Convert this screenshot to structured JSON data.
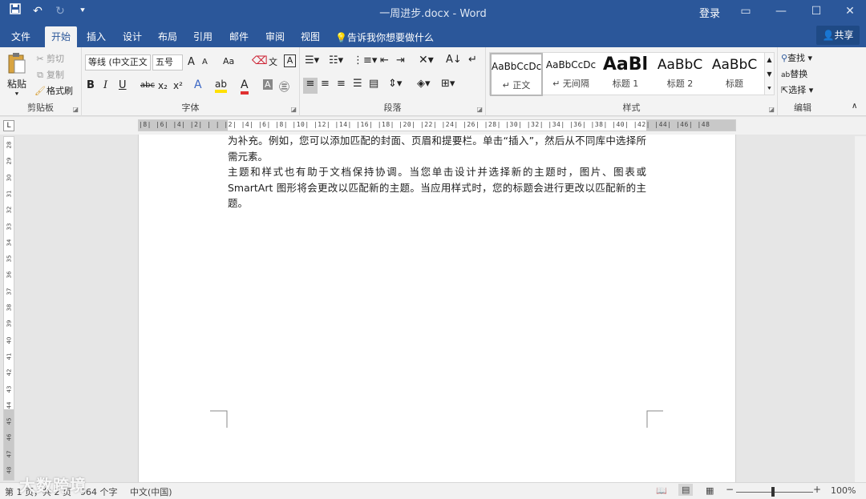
{
  "titlebar": {
    "title": "一周进步.docx - Word",
    "login": "登录",
    "qat": {
      "save_icon": "save-icon",
      "undo_icon": "undo-icon",
      "redo_icon": "redo-icon",
      "customize_icon": "customize-icon"
    },
    "window_buttons": {
      "ribbon_display": "▭",
      "minimize": "—",
      "maximize": "☐",
      "close": "✕"
    }
  },
  "tabs": [
    {
      "label": "文件"
    },
    {
      "label": "开始"
    },
    {
      "label": "插入"
    },
    {
      "label": "设计"
    },
    {
      "label": "布局"
    },
    {
      "label": "引用"
    },
    {
      "label": "邮件"
    },
    {
      "label": "审阅"
    },
    {
      "label": "视图"
    }
  ],
  "tellme": "告诉我你想要做什么",
  "share": "共享",
  "ribbon": {
    "clipboard": {
      "paste": "粘贴",
      "cut": "剪切",
      "copy": "复制",
      "format_painter": "格式刷",
      "label": "剪贴板"
    },
    "font": {
      "font_name": "等线 (中文正文",
      "font_size": "五号",
      "grow": "A",
      "shrink": "A",
      "case": "Aa",
      "bold": "B",
      "italic": "I",
      "underline": "U",
      "strike": "abc",
      "sub": "x₂",
      "sup": "x²",
      "label": "字体"
    },
    "paragraph": {
      "label": "段落"
    },
    "styles": {
      "label": "样式",
      "items": [
        {
          "preview": "AaBbCcDc",
          "name": "↵ 正文"
        },
        {
          "preview": "AaBbCcDc",
          "name": "↵ 无间隔"
        },
        {
          "preview": "AaBl",
          "name": "标题 1"
        },
        {
          "preview": "AaBbC",
          "name": "标题 2"
        },
        {
          "preview": "AaBbC",
          "name": "标题"
        }
      ]
    },
    "editing": {
      "find": "查找",
      "replace": "替换",
      "select": "选择",
      "label": "编辑"
    }
  },
  "ruler": {
    "numbers": "|8| |6| |4| |2| | | |2| |4| |6| |8| |10| |12| |14| |16| |18| |20| |22| |24| |26| |28| |30| |32| |34| |36| |38| |40| |42| |44| |46| |48",
    "corner": "L",
    "vertical": [
      "28",
      "29",
      "30",
      "31",
      "32",
      "33",
      "34",
      "35",
      "36",
      "37",
      "38",
      "39",
      "40",
      "41",
      "42",
      "43",
      "44",
      "45",
      "46",
      "47",
      "48",
      "49"
    ]
  },
  "document": {
    "paragraphs": [
      "为补充。例如，您可以添加匹配的封面、页眉和提要栏。单击“插入”，然后从不同库中选择所需元素。",
      "主题和样式也有助于文档保持协调。当您单击设计并选择新的主题时，图片、图表或 SmartArt 图形将会更改以匹配新的主题。当应用样式时，您的标题会进行更改以匹配新的主题。"
    ]
  },
  "status": {
    "page": "第 1 页，共 2 页",
    "words": "964 个字",
    "lang": "中文(中国)",
    "zoom": "100%",
    "zoom_minus": "−",
    "zoom_plus": "+",
    "watermark": "大数跨境"
  }
}
